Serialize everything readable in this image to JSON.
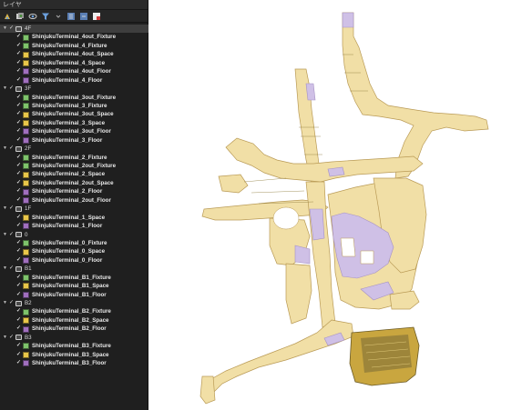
{
  "panel": {
    "title": "レイヤ"
  },
  "toolbar": {
    "buttons": [
      {
        "name": "open-layer-styling-button",
        "icon": "paint-icon"
      },
      {
        "name": "add-group-button",
        "icon": "add-group-icon"
      },
      {
        "name": "manage-map-themes-button",
        "icon": "eye-icon"
      },
      {
        "name": "filter-legend-button",
        "icon": "filter-icon"
      },
      {
        "name": "expand-all-button",
        "icon": "expand-all-icon"
      },
      {
        "name": "collapse-all-button",
        "icon": "collapse-all-icon"
      },
      {
        "name": "remove-layer-button",
        "icon": "remove-layer-icon"
      }
    ]
  },
  "colors": {
    "fixture": "#7ec36b",
    "space": "#e8c64a",
    "floor": "#a06fbe",
    "map_space_fill": "#f1dfa6",
    "map_space_stroke": "#b99a55",
    "map_floor_fill": "#cfc0e6",
    "map_fixture_dark": "#8d7a3a"
  },
  "groups": [
    {
      "label": "4F",
      "selected": true,
      "layers": [
        {
          "label": "ShinjukuTerminal_4out_Fixture",
          "kind": "fixture"
        },
        {
          "label": "ShinjukuTerminal_4_Fixture",
          "kind": "fixture"
        },
        {
          "label": "ShinjukuTerminal_4out_Space",
          "kind": "space"
        },
        {
          "label": "ShinjukuTerminal_4_Space",
          "kind": "space"
        },
        {
          "label": "ShinjukuTerminal_4out_Floor",
          "kind": "floor"
        },
        {
          "label": "ShinjukuTerminal_4_Floor",
          "kind": "floor"
        }
      ]
    },
    {
      "label": "3F",
      "selected": false,
      "layers": [
        {
          "label": "ShinjukuTerminal_3out_Fixture",
          "kind": "fixture"
        },
        {
          "label": "ShinjukuTerminal_3_Fixture",
          "kind": "fixture"
        },
        {
          "label": "ShinjukuTerminal_3out_Space",
          "kind": "space"
        },
        {
          "label": "ShinjukuTerminal_3_Space",
          "kind": "space"
        },
        {
          "label": "ShinjukuTerminal_3out_Floor",
          "kind": "floor"
        },
        {
          "label": "ShinjukuTerminal_3_Floor",
          "kind": "floor"
        }
      ]
    },
    {
      "label": "2F",
      "selected": false,
      "layers": [
        {
          "label": "ShinjukuTerminal_2_Fixture",
          "kind": "fixture"
        },
        {
          "label": "ShinjukuTerminal_2out_Fixture",
          "kind": "fixture"
        },
        {
          "label": "ShinjukuTerminal_2_Space",
          "kind": "space"
        },
        {
          "label": "ShinjukuTerminal_2out_Space",
          "kind": "space"
        },
        {
          "label": "ShinjukuTerminal_2_Floor",
          "kind": "floor"
        },
        {
          "label": "ShinjukuTerminal_2out_Floor",
          "kind": "floor"
        }
      ]
    },
    {
      "label": "1F",
      "selected": false,
      "layers": [
        {
          "label": "ShinjukuTerminal_1_Space",
          "kind": "space"
        },
        {
          "label": "ShinjukuTerminal_1_Floor",
          "kind": "floor"
        }
      ]
    },
    {
      "label": "0",
      "selected": false,
      "layers": [
        {
          "label": "ShinjukuTerminal_0_Fixture",
          "kind": "fixture"
        },
        {
          "label": "ShinjukuTerminal_0_Space",
          "kind": "space"
        },
        {
          "label": "ShinjukuTerminal_0_Floor",
          "kind": "floor"
        }
      ]
    },
    {
      "label": "B1",
      "selected": false,
      "layers": [
        {
          "label": "ShinjukuTerminal_B1_Fixture",
          "kind": "fixture"
        },
        {
          "label": "ShinjukuTerminal_B1_Space",
          "kind": "space"
        },
        {
          "label": "ShinjukuTerminal_B1_Floor",
          "kind": "floor"
        }
      ]
    },
    {
      "label": "B2",
      "selected": false,
      "layers": [
        {
          "label": "ShinjukuTerminal_B2_Fixture",
          "kind": "fixture"
        },
        {
          "label": "ShinjukuTerminal_B2_Space",
          "kind": "space"
        },
        {
          "label": "ShinjukuTerminal_B2_Floor",
          "kind": "floor"
        }
      ]
    },
    {
      "label": "B3",
      "selected": false,
      "layers": [
        {
          "label": "ShinjukuTerminal_B3_Fixture",
          "kind": "fixture"
        },
        {
          "label": "ShinjukuTerminal_B3_Space",
          "kind": "space"
        },
        {
          "label": "ShinjukuTerminal_B3_Floor",
          "kind": "floor"
        }
      ]
    }
  ]
}
